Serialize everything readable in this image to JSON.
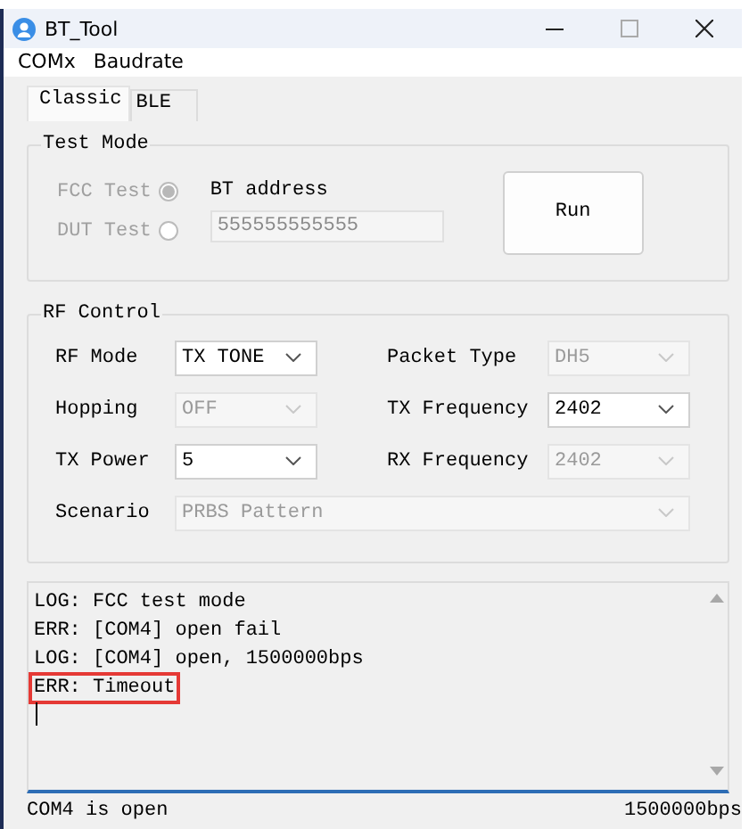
{
  "window": {
    "title": "BT_Tool"
  },
  "menu": [
    {
      "label": "COMx"
    },
    {
      "label": "Baudrate"
    }
  ],
  "tabs": [
    {
      "label": "Classic",
      "selected": true
    },
    {
      "label": "BLE",
      "selected": false
    }
  ],
  "test_mode": {
    "title": "Test Mode",
    "options": [
      {
        "label": "FCC Test",
        "selected": true,
        "disabled": true
      },
      {
        "label": "DUT Test",
        "selected": false,
        "disabled": true
      }
    ],
    "address_label": "BT address",
    "address": {
      "value": "555555555555",
      "disabled": true
    },
    "run_button": "Run"
  },
  "rf_control": {
    "title": "RF Control",
    "fields": [
      {
        "label": "RF Mode",
        "value": "TX TONE",
        "disabled": false,
        "kind": "half"
      },
      {
        "label": "Packet Type",
        "value": "DH5",
        "disabled": true,
        "kind": "half"
      },
      {
        "label": "Hopping",
        "value": "OFF",
        "disabled": true,
        "kind": "half"
      },
      {
        "label": "TX Frequency",
        "value": "2402",
        "disabled": false,
        "kind": "half"
      },
      {
        "label": "TX Power",
        "value": "5",
        "disabled": false,
        "kind": "half"
      },
      {
        "label": "RX Frequency",
        "value": "2402",
        "disabled": true,
        "kind": "half"
      },
      {
        "label": "Scenario",
        "value": "PRBS Pattern",
        "disabled": true,
        "kind": "full"
      }
    ]
  },
  "log": {
    "lines": [
      {
        "text": "LOG: FCC test mode",
        "highlighted": false
      },
      {
        "text": "ERR: [COM4] open fail",
        "highlighted": false
      },
      {
        "text": "LOG: [COM4] open, 1500000bps",
        "highlighted": false
      },
      {
        "text": "ERR: Timeout",
        "highlighted": true
      }
    ]
  },
  "status_bar": [
    "COM4 is open",
    "1500000bps"
  ]
}
